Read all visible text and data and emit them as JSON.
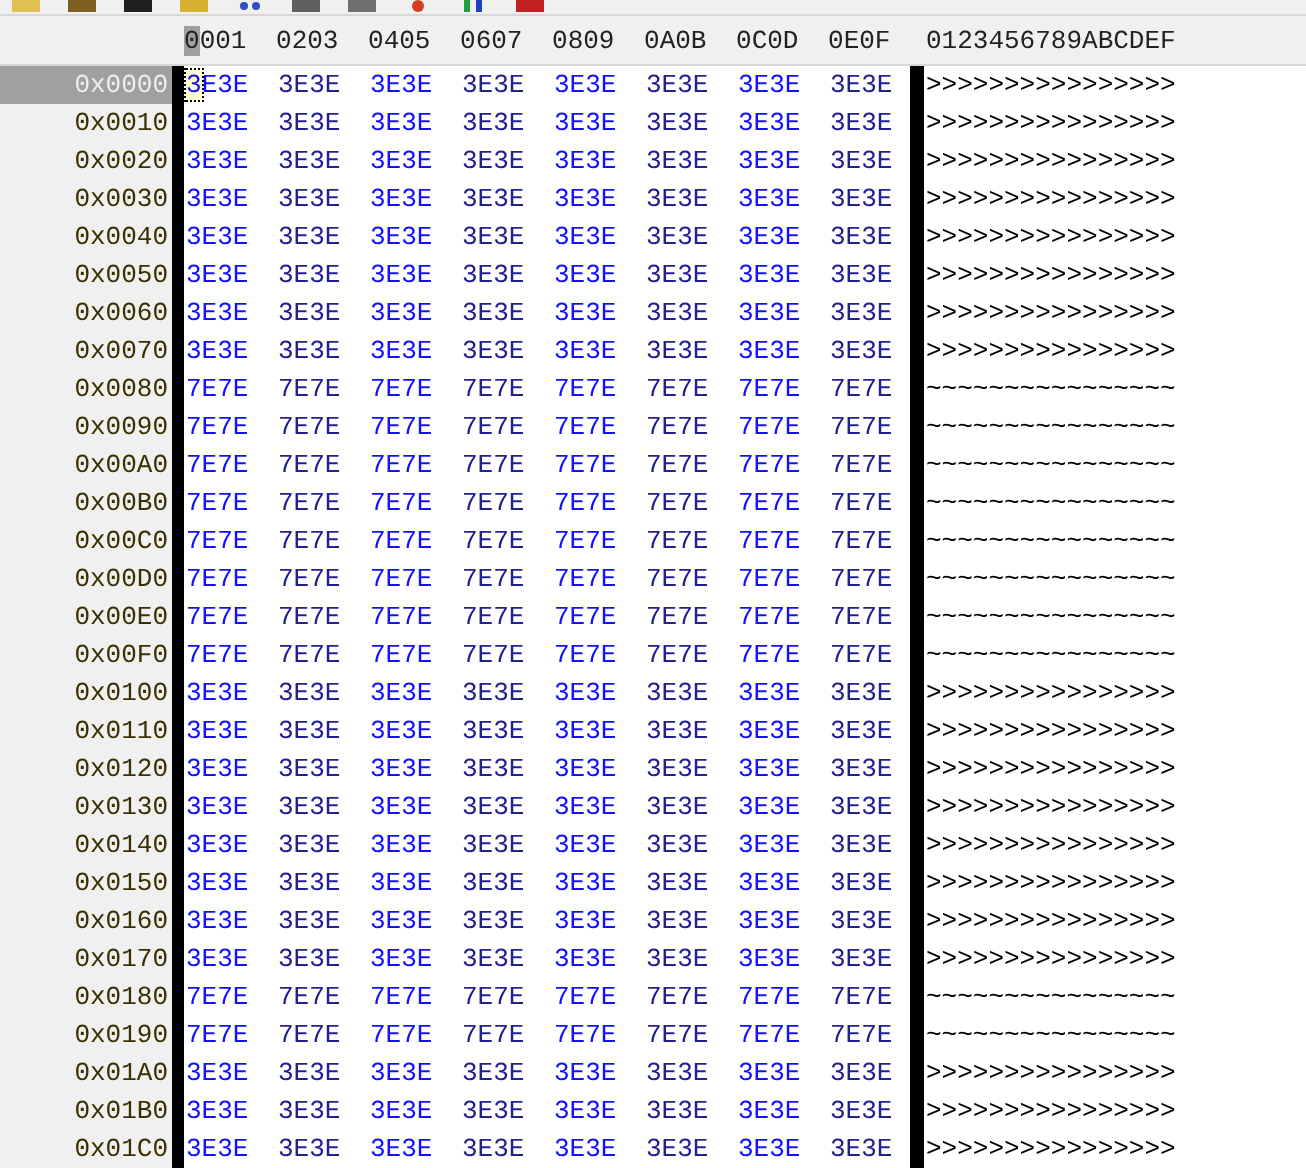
{
  "header": {
    "columns": [
      {
        "label": "0001",
        "selected": true
      },
      {
        "label": "0203",
        "selected": false
      },
      {
        "label": "0405",
        "selected": false
      },
      {
        "label": "0607",
        "selected": false
      },
      {
        "label": "0809",
        "selected": false
      },
      {
        "label": "0A0B",
        "selected": false
      },
      {
        "label": "0C0D",
        "selected": false
      },
      {
        "label": "0E0F",
        "selected": false
      }
    ],
    "ascii": "0123456789ABCDEF"
  },
  "rows": [
    {
      "address": "0x0000",
      "selected": true,
      "cells": [
        "3E3E",
        "3E3E",
        "3E3E",
        "3E3E",
        "3E3E",
        "3E3E",
        "3E3E",
        "3E3E"
      ],
      "ascii": ">>>>>>>>>>>>>>>>"
    },
    {
      "address": "0x0010",
      "selected": false,
      "cells": [
        "3E3E",
        "3E3E",
        "3E3E",
        "3E3E",
        "3E3E",
        "3E3E",
        "3E3E",
        "3E3E"
      ],
      "ascii": ">>>>>>>>>>>>>>>>"
    },
    {
      "address": "0x0020",
      "selected": false,
      "cells": [
        "3E3E",
        "3E3E",
        "3E3E",
        "3E3E",
        "3E3E",
        "3E3E",
        "3E3E",
        "3E3E"
      ],
      "ascii": ">>>>>>>>>>>>>>>>"
    },
    {
      "address": "0x0030",
      "selected": false,
      "cells": [
        "3E3E",
        "3E3E",
        "3E3E",
        "3E3E",
        "3E3E",
        "3E3E",
        "3E3E",
        "3E3E"
      ],
      "ascii": ">>>>>>>>>>>>>>>>"
    },
    {
      "address": "0x0040",
      "selected": false,
      "cells": [
        "3E3E",
        "3E3E",
        "3E3E",
        "3E3E",
        "3E3E",
        "3E3E",
        "3E3E",
        "3E3E"
      ],
      "ascii": ">>>>>>>>>>>>>>>>"
    },
    {
      "address": "0x0050",
      "selected": false,
      "cells": [
        "3E3E",
        "3E3E",
        "3E3E",
        "3E3E",
        "3E3E",
        "3E3E",
        "3E3E",
        "3E3E"
      ],
      "ascii": ">>>>>>>>>>>>>>>>"
    },
    {
      "address": "0x0060",
      "selected": false,
      "cells": [
        "3E3E",
        "3E3E",
        "3E3E",
        "3E3E",
        "3E3E",
        "3E3E",
        "3E3E",
        "3E3E"
      ],
      "ascii": ">>>>>>>>>>>>>>>>"
    },
    {
      "address": "0x0070",
      "selected": false,
      "cells": [
        "3E3E",
        "3E3E",
        "3E3E",
        "3E3E",
        "3E3E",
        "3E3E",
        "3E3E",
        "3E3E"
      ],
      "ascii": ">>>>>>>>>>>>>>>>"
    },
    {
      "address": "0x0080",
      "selected": false,
      "cells": [
        "7E7E",
        "7E7E",
        "7E7E",
        "7E7E",
        "7E7E",
        "7E7E",
        "7E7E",
        "7E7E"
      ],
      "ascii": "~~~~~~~~~~~~~~~~"
    },
    {
      "address": "0x0090",
      "selected": false,
      "cells": [
        "7E7E",
        "7E7E",
        "7E7E",
        "7E7E",
        "7E7E",
        "7E7E",
        "7E7E",
        "7E7E"
      ],
      "ascii": "~~~~~~~~~~~~~~~~"
    },
    {
      "address": "0x00A0",
      "selected": false,
      "cells": [
        "7E7E",
        "7E7E",
        "7E7E",
        "7E7E",
        "7E7E",
        "7E7E",
        "7E7E",
        "7E7E"
      ],
      "ascii": "~~~~~~~~~~~~~~~~"
    },
    {
      "address": "0x00B0",
      "selected": false,
      "cells": [
        "7E7E",
        "7E7E",
        "7E7E",
        "7E7E",
        "7E7E",
        "7E7E",
        "7E7E",
        "7E7E"
      ],
      "ascii": "~~~~~~~~~~~~~~~~"
    },
    {
      "address": "0x00C0",
      "selected": false,
      "cells": [
        "7E7E",
        "7E7E",
        "7E7E",
        "7E7E",
        "7E7E",
        "7E7E",
        "7E7E",
        "7E7E"
      ],
      "ascii": "~~~~~~~~~~~~~~~~"
    },
    {
      "address": "0x00D0",
      "selected": false,
      "cells": [
        "7E7E",
        "7E7E",
        "7E7E",
        "7E7E",
        "7E7E",
        "7E7E",
        "7E7E",
        "7E7E"
      ],
      "ascii": "~~~~~~~~~~~~~~~~"
    },
    {
      "address": "0x00E0",
      "selected": false,
      "cells": [
        "7E7E",
        "7E7E",
        "7E7E",
        "7E7E",
        "7E7E",
        "7E7E",
        "7E7E",
        "7E7E"
      ],
      "ascii": "~~~~~~~~~~~~~~~~"
    },
    {
      "address": "0x00F0",
      "selected": false,
      "cells": [
        "7E7E",
        "7E7E",
        "7E7E",
        "7E7E",
        "7E7E",
        "7E7E",
        "7E7E",
        "7E7E"
      ],
      "ascii": "~~~~~~~~~~~~~~~~"
    },
    {
      "address": "0x0100",
      "selected": false,
      "cells": [
        "3E3E",
        "3E3E",
        "3E3E",
        "3E3E",
        "3E3E",
        "3E3E",
        "3E3E",
        "3E3E"
      ],
      "ascii": ">>>>>>>>>>>>>>>>"
    },
    {
      "address": "0x0110",
      "selected": false,
      "cells": [
        "3E3E",
        "3E3E",
        "3E3E",
        "3E3E",
        "3E3E",
        "3E3E",
        "3E3E",
        "3E3E"
      ],
      "ascii": ">>>>>>>>>>>>>>>>"
    },
    {
      "address": "0x0120",
      "selected": false,
      "cells": [
        "3E3E",
        "3E3E",
        "3E3E",
        "3E3E",
        "3E3E",
        "3E3E",
        "3E3E",
        "3E3E"
      ],
      "ascii": ">>>>>>>>>>>>>>>>"
    },
    {
      "address": "0x0130",
      "selected": false,
      "cells": [
        "3E3E",
        "3E3E",
        "3E3E",
        "3E3E",
        "3E3E",
        "3E3E",
        "3E3E",
        "3E3E"
      ],
      "ascii": ">>>>>>>>>>>>>>>>"
    },
    {
      "address": "0x0140",
      "selected": false,
      "cells": [
        "3E3E",
        "3E3E",
        "3E3E",
        "3E3E",
        "3E3E",
        "3E3E",
        "3E3E",
        "3E3E"
      ],
      "ascii": ">>>>>>>>>>>>>>>>"
    },
    {
      "address": "0x0150",
      "selected": false,
      "cells": [
        "3E3E",
        "3E3E",
        "3E3E",
        "3E3E",
        "3E3E",
        "3E3E",
        "3E3E",
        "3E3E"
      ],
      "ascii": ">>>>>>>>>>>>>>>>"
    },
    {
      "address": "0x0160",
      "selected": false,
      "cells": [
        "3E3E",
        "3E3E",
        "3E3E",
        "3E3E",
        "3E3E",
        "3E3E",
        "3E3E",
        "3E3E"
      ],
      "ascii": ">>>>>>>>>>>>>>>>"
    },
    {
      "address": "0x0170",
      "selected": false,
      "cells": [
        "3E3E",
        "3E3E",
        "3E3E",
        "3E3E",
        "3E3E",
        "3E3E",
        "3E3E",
        "3E3E"
      ],
      "ascii": ">>>>>>>>>>>>>>>>"
    },
    {
      "address": "0x0180",
      "selected": false,
      "cells": [
        "7E7E",
        "7E7E",
        "7E7E",
        "7E7E",
        "7E7E",
        "7E7E",
        "7E7E",
        "7E7E"
      ],
      "ascii": "~~~~~~~~~~~~~~~~"
    },
    {
      "address": "0x0190",
      "selected": false,
      "cells": [
        "7E7E",
        "7E7E",
        "7E7E",
        "7E7E",
        "7E7E",
        "7E7E",
        "7E7E",
        "7E7E"
      ],
      "ascii": "~~~~~~~~~~~~~~~~"
    },
    {
      "address": "0x01A0",
      "selected": false,
      "cells": [
        "3E3E",
        "3E3E",
        "3E3E",
        "3E3E",
        "3E3E",
        "3E3E",
        "3E3E",
        "3E3E"
      ],
      "ascii": ">>>>>>>>>>>>>>>>"
    },
    {
      "address": "0x01B0",
      "selected": false,
      "cells": [
        "3E3E",
        "3E3E",
        "3E3E",
        "3E3E",
        "3E3E",
        "3E3E",
        "3E3E",
        "3E3E"
      ],
      "ascii": ">>>>>>>>>>>>>>>>"
    },
    {
      "address": "0x01C0",
      "selected": false,
      "cells": [
        "3E3E",
        "3E3E",
        "3E3E",
        "3E3E",
        "3E3E",
        "3E3E",
        "3E3E",
        "3E3E"
      ],
      "ascii": ">>>>>>>>>>>>>>>>"
    }
  ]
}
